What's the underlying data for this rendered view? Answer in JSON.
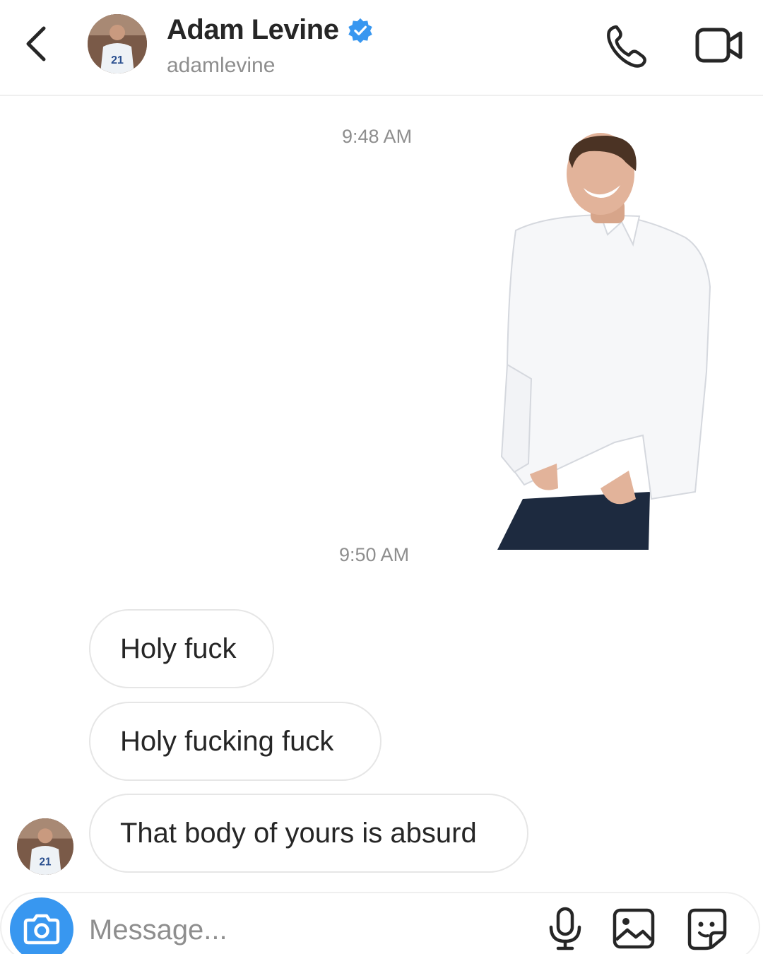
{
  "header": {
    "name": "Adam Levine",
    "handle": "adamlevine",
    "verified": true,
    "icons": [
      "back-chevron-icon",
      "verified-badge-icon",
      "phone-icon",
      "video-camera-icon"
    ],
    "accent_color": "#3897f0"
  },
  "messages": {
    "timestamp_1": "9:48 AM",
    "timestamp_2": "9:50 AM",
    "bubbles": [
      {
        "text": "Holy fuck"
      },
      {
        "text": "Holy fucking fuck"
      },
      {
        "text": "That body of yours is absurd"
      }
    ]
  },
  "composer": {
    "placeholder": "Message...",
    "icons": [
      "camera-icon",
      "microphone-icon",
      "gallery-icon",
      "sticker-icon"
    ]
  }
}
